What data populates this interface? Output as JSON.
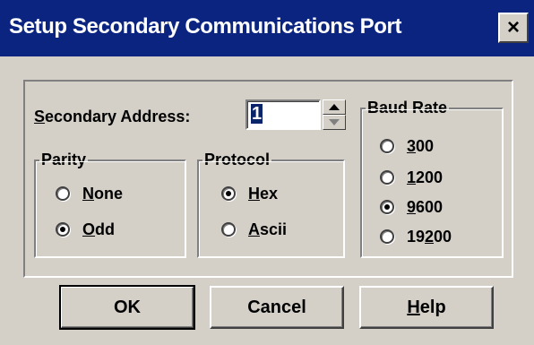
{
  "window": {
    "title": "Setup Secondary Communications Port",
    "close_label": "×"
  },
  "address": {
    "label_before": "",
    "label_mnemonic": "S",
    "label_after": "econdary Address:",
    "value": "1"
  },
  "parity": {
    "label": "Parity",
    "options": [
      {
        "mnemonic": "N",
        "rest": "one",
        "checked": false
      },
      {
        "mnemonic": "O",
        "rest": "dd",
        "checked": true
      }
    ]
  },
  "protocol": {
    "label": "Protocol",
    "options": [
      {
        "mnemonic": "H",
        "rest": "ex",
        "checked": true
      },
      {
        "mnemonic": "A",
        "rest": "scii",
        "checked": false
      }
    ]
  },
  "baud": {
    "label": "Baud Rate",
    "options": [
      {
        "before": "",
        "mnemonic": "3",
        "rest": "00",
        "checked": false
      },
      {
        "before": "",
        "mnemonic": "1",
        "rest": "200",
        "checked": false
      },
      {
        "before": "",
        "mnemonic": "9",
        "rest": "600",
        "checked": true
      },
      {
        "before": "19",
        "mnemonic": "2",
        "rest": "00",
        "checked": false
      }
    ]
  },
  "buttons": {
    "ok": "OK",
    "cancel": "Cancel",
    "help_mnemonic": "H",
    "help_rest": "elp"
  }
}
